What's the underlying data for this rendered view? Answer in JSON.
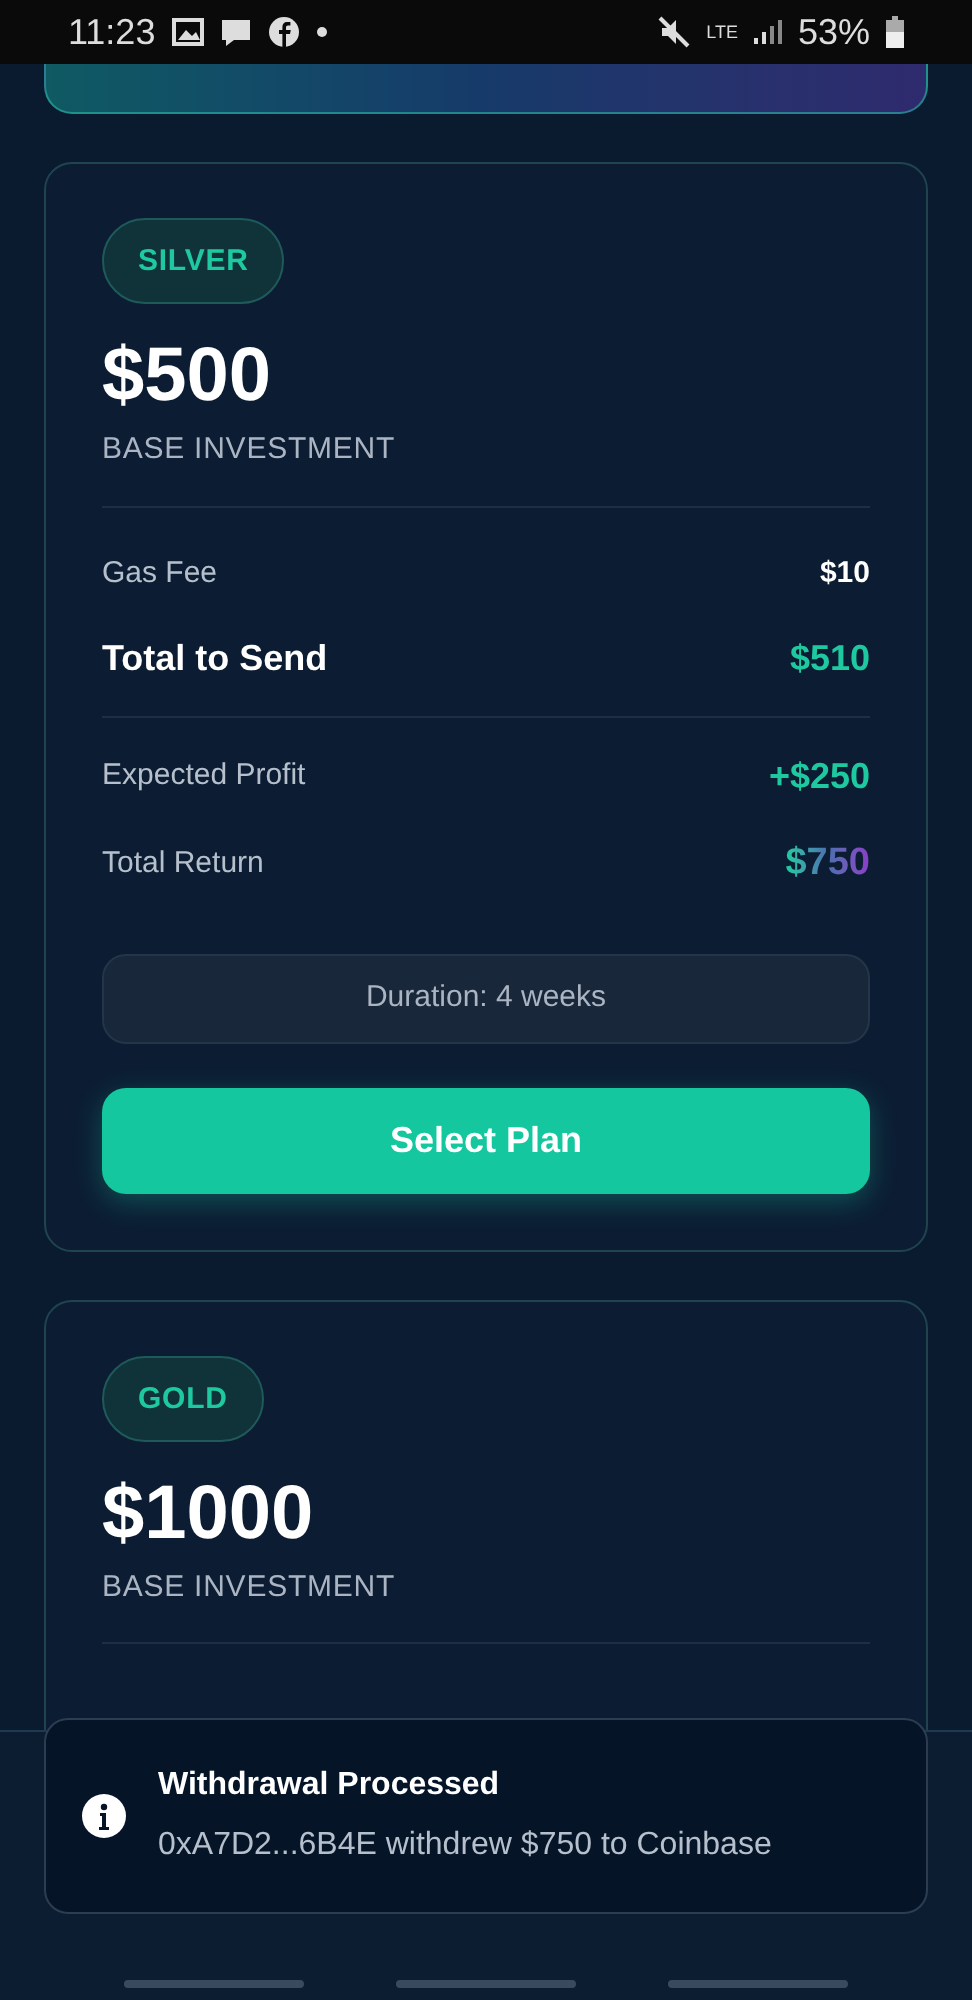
{
  "status_bar": {
    "time": "11:23",
    "network": "LTE",
    "battery": "53%"
  },
  "plans": [
    {
      "tier": "SILVER",
      "price": "$500",
      "price_label": "BASE INVESTMENT",
      "rows": [
        {
          "kind": "plain",
          "label": "Gas Fee",
          "value": "$10"
        },
        {
          "kind": "total",
          "label": "Total to Send",
          "value": "$510"
        },
        {
          "kind": "divider"
        },
        {
          "kind": "profit",
          "label": "Expected Profit",
          "value": "+$250"
        },
        {
          "kind": "return",
          "label": "Total Return",
          "value": "$750"
        }
      ],
      "duration": "Duration: 4 weeks",
      "button": "Select Plan"
    },
    {
      "tier": "GOLD",
      "price": "$1000",
      "price_label": "BASE INVESTMENT"
    }
  ],
  "toast": {
    "title": "Withdrawal Processed",
    "message": "0xA7D2...6B4E withdrew $750 to Coinbase"
  }
}
